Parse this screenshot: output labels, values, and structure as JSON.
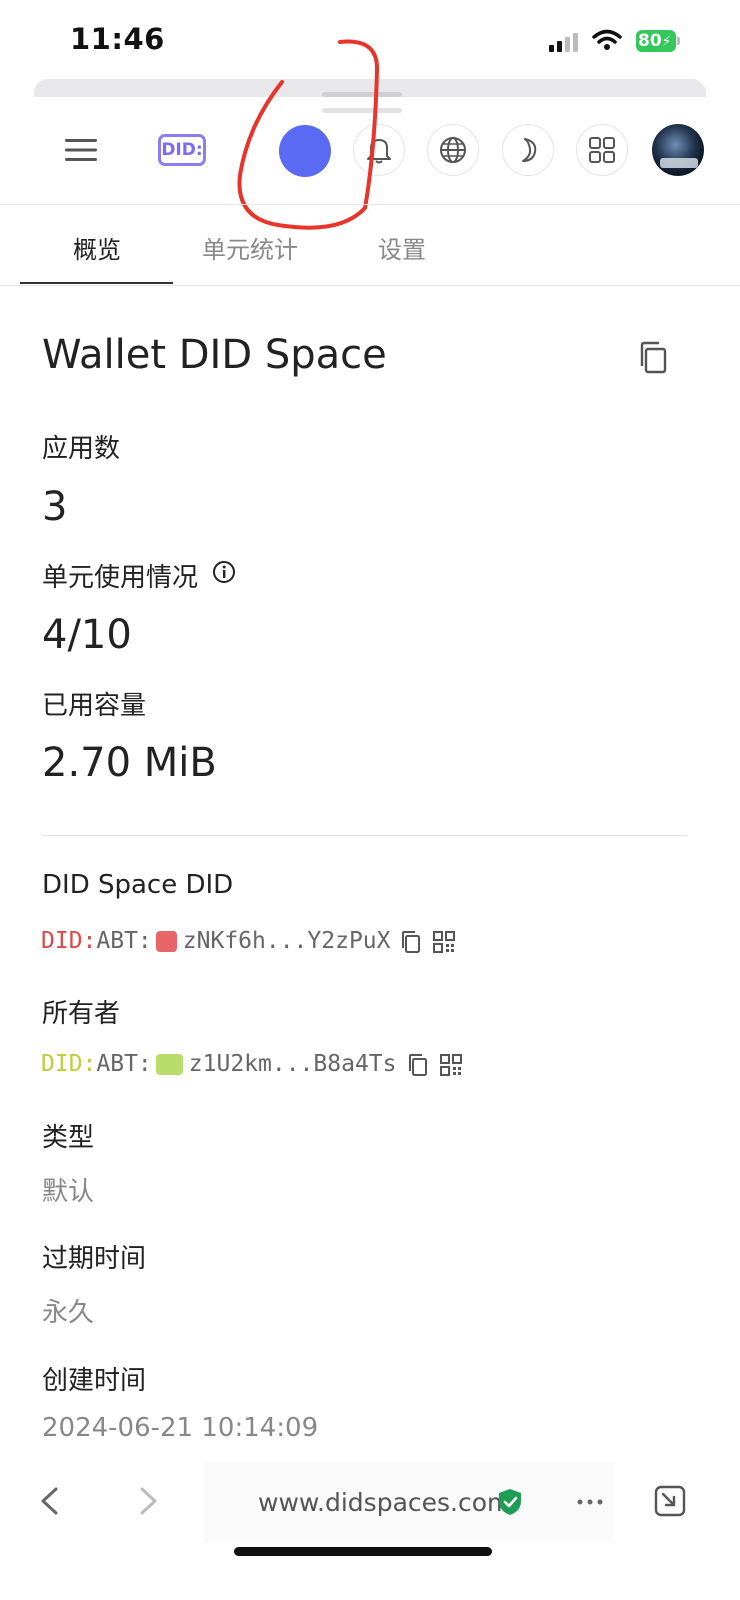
{
  "status_bar": {
    "time": "11:46",
    "battery": "80"
  },
  "header": {
    "logo_text": "DID:"
  },
  "tabs": [
    "概览",
    "单元统计",
    "设置"
  ],
  "space": {
    "title": "Wallet DID Space",
    "apps_label": "应用数",
    "apps_value": "3",
    "units_label": "单元使用情况",
    "units_value": "4/10",
    "capacity_label": "已用容量",
    "capacity_value": "2.70 MiB",
    "space_did_label": "DID Space DID",
    "space_did": {
      "prefix": "DID:",
      "middle": "ABT:",
      "short": "zNKf6h...Y2zPuX",
      "prefix_color": "#e0464b",
      "avatar_color": "#e8666a"
    },
    "owner_label": "所有者",
    "owner_did": {
      "prefix": "DID:",
      "middle": "ABT:",
      "short": "z1U2km...B8a4Ts",
      "prefix_color": "#b8d33a",
      "avatar_color": "#b9dd6b"
    },
    "type_label": "类型",
    "type_value": "默认",
    "expire_label": "过期时间",
    "expire_value": "永久",
    "created_label": "创建时间",
    "created_value": "2024-06-21 10:14:09"
  },
  "browser": {
    "url": "www.didspaces.com"
  },
  "colors": {
    "accent_circle": "#5b6af2",
    "annotation_stroke": "#e8352c",
    "secure_shield": "#1f9d55"
  }
}
